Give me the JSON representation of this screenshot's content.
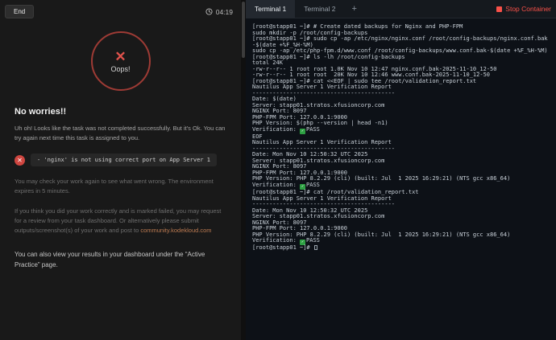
{
  "colors": {
    "accent_red": "#f85149",
    "error_red": "#cf4640",
    "check_green": "#2ea043",
    "link_orange": "#bd7b52"
  },
  "left_panel": {
    "end_button_label": "End",
    "timer": "04:19",
    "oops_x": "✕",
    "oops_label": "Oops!",
    "heading": "No worries!!",
    "intro": "Uh oh! Looks like the task was not completed successfully. But it's Ok. You can try again next time this task is assigned to you.",
    "error_message": "- 'nginx' is not using correct port on App Server 1",
    "check_note": "You may check your work again to see what went wrong. The environment expires in 5 minutes.",
    "review_note": "If you think you did your work correctly and is marked failed, you may request for a review from your task dashboard. Or alternatively please submit outputs/screenshot(s) of your work and post to ",
    "community_link": "community.kodekloud.com",
    "dashboard_note": "You can also view your results in your dashboard under the “Active Practice” page."
  },
  "terminal": {
    "tabs": [
      {
        "label": "Terminal 1"
      },
      {
        "label": "Terminal 2"
      }
    ],
    "new_tab_label": "+",
    "stop_button_label": "Stop Container",
    "lines": [
      "[root@stapp01 ~]# # Create dated backups for Nginx and PHP-FPM",
      "sudo mkdir -p /root/config-backups",
      "[root@stapp01 ~]# sudo cp -ap /etc/nginx/nginx.conf /root/config-backups/nginx.conf.bak-$(date +%F_%H-%M)",
      "sudo cp -ap /etc/php-fpm.d/www.conf /root/config-backups/www.conf.bak-$(date +%F_%H-%M)",
      "[root@stapp01 ~]# ls -lh /root/config-backups",
      "total 24K",
      "-rw-r--r-- 1 root root 1.0K Nov 10 12:47 nginx.conf.bak-2025-11-10_12-50",
      "-rw-r--r-- 1 root root  20K Nov 10 12:46 www.conf.bak-2025-11-10_12-50",
      "[root@stapp01 ~]# cat <<EOF | sudo tee /root/validation_report.txt",
      "Nautilus App Server 1 Verification Report",
      "------------------------------------------",
      "Date: $(date)",
      "Server: stapp01.stratos.xfusioncorp.com",
      "NGINX Port: 8097",
      "PHP-FPM Port: 127.0.0.1:9000",
      "PHP Version: $(php --version | head -n1)",
      "Verification: ✅PASS",
      "EOF",
      "Nautilus App Server 1 Verification Report",
      "------------------------------------------",
      "Date: Mon Nov 10 12:50:32 UTC 2025",
      "Server: stapp01.stratos.xfusioncorp.com",
      "NGINX Port: 8097",
      "PHP-FPM Port: 127.0.0.1:9000",
      "PHP Version: PHP 8.2.29 (cli) (built: Jul  1 2025 16:29:21) (NTS gcc x86_64)",
      "Verification: ✅PASS",
      "[root@stapp01 ~]# cat /root/validation_report.txt",
      "Nautilus App Server 1 Verification Report",
      "------------------------------------------",
      "Date: Mon Nov 10 12:50:32 UTC 2025",
      "Server: stapp01.stratos.xfusioncorp.com",
      "NGINX Port: 8097",
      "PHP-FPM Port: 127.0.0.1:9000",
      "PHP Version: PHP 8.2.29 (cli) (built: Jul  1 2025 16:29:21) (NTS gcc x86_64)",
      "Verification: ✅PASS",
      "[root@stapp01 ~]# "
    ]
  }
}
